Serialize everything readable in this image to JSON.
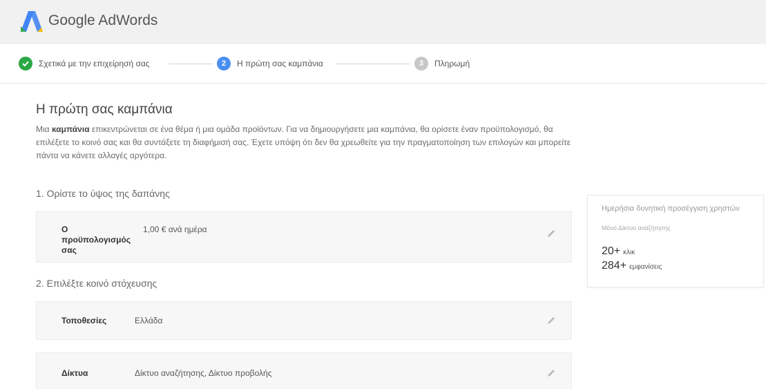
{
  "header": {
    "brand": "Google AdWords",
    "colors": {
      "blue": "#4285f4",
      "green": "#34a853",
      "yellow": "#fbbc05"
    }
  },
  "stepper": {
    "steps": [
      {
        "label": "Σχετικά με την επιχείρησή σας",
        "state": "done",
        "icon": "check-icon"
      },
      {
        "label": "Η πρώτη σας καμπάνια",
        "state": "active",
        "number": "2"
      },
      {
        "label": "Πληρωμή",
        "state": "pending",
        "number": "3"
      }
    ]
  },
  "main": {
    "title": "Η πρώτη σας καμπάνια",
    "intro": {
      "prefix": "Μια ",
      "bold": "καμπάνια",
      "rest": " επικεντρώνεται σε ένα θέμα ή μια ομάδα προϊόντων. Για να δημιουργήσετε μια καμπάνια, θα ορίσετε έναν προϋπολογισμό, θα επιλέξετε το κοινό σας και θα συντάξετε τη διαφήμισή σας. Έχετε υπόψη ότι δεν θα χρεωθείτε για την πραγματοποίηση των επιλογών και μπορείτε πάντα να κάνετε αλλαγές αργότερα."
    },
    "section1": {
      "title": "1. Ορίστε το ύψος της δαπάνης",
      "budget": {
        "key": "Ο προϋπολογισμός σας",
        "value": "1,00 € ανά ημέρα"
      }
    },
    "section2": {
      "title": "2. Επιλέξτε κοινό στόχευσης",
      "locations": {
        "key": "Τοποθεσίες",
        "value": "Ελλάδα"
      },
      "networks": {
        "key": "Δίκτυα",
        "value": "Δίκτυο αναζήτησης, Δίκτυο προβολής"
      }
    }
  },
  "side": {
    "title": "Ημερήσια δυνητική προσέγγιση χρηστών",
    "subtitle": "Μόνο Δίκτυο αναζήτησης",
    "clicks": {
      "value": "20+",
      "unit": "κλικ"
    },
    "impressions": {
      "value": "284+",
      "unit": "εμφανίσεις"
    }
  }
}
